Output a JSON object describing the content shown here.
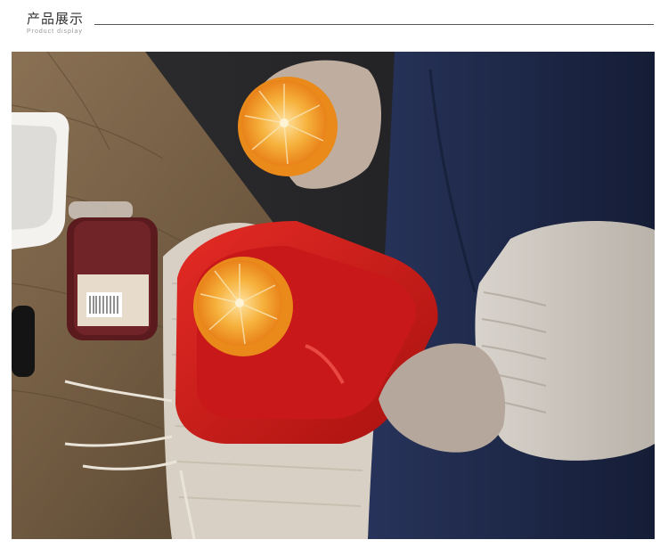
{
  "header": {
    "title": "产品展示",
    "subtitle": "Product display"
  },
  "photo": {
    "subject": "product-photo",
    "colors": {
      "dish": "#d81e1e",
      "orange": "#f19a22",
      "table": "#7a6248",
      "apron": "#1f2a4a"
    }
  }
}
